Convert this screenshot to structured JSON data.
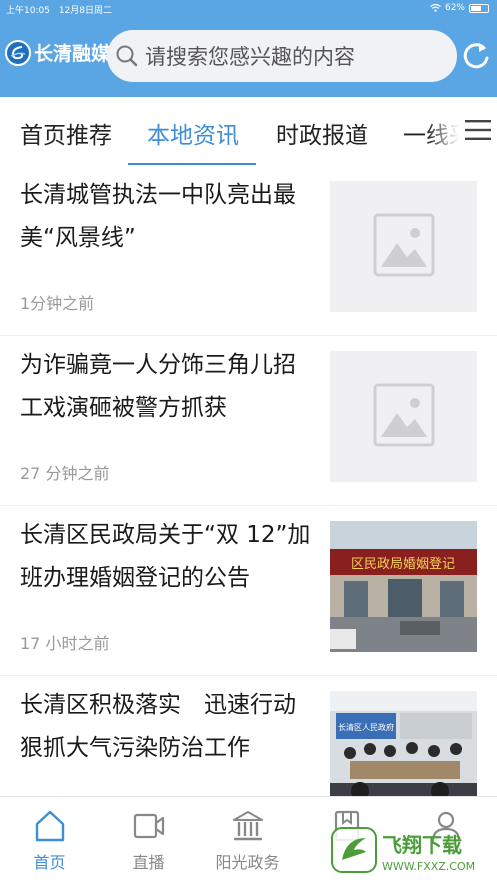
{
  "status_bar": {
    "time": "上午10:05",
    "date": "12月8日周二",
    "battery": "62%",
    "battery_level": 0.62
  },
  "header": {
    "app_name": "长清融媒",
    "search_placeholder": "请搜索您感兴趣的内容",
    "accent_color": "#5aa6e4"
  },
  "tabs": [
    {
      "label": "首页推荐",
      "active": false
    },
    {
      "label": "本地资讯",
      "active": true
    },
    {
      "label": "时政报道",
      "active": false
    },
    {
      "label": "一线采",
      "active": false
    }
  ],
  "news": [
    {
      "title": "长清城管执法一中队亮出最美“风景线”",
      "time": "1分钟之前",
      "image": "placeholder"
    },
    {
      "title": "为诈骗竟一人分饰三角儿招工戏演砸被警方抓获",
      "time": "27 分钟之前",
      "image": "placeholder"
    },
    {
      "title": "长清区民政局关于“双 12”加班办理婚姻登记的公告",
      "time": "17 小时之前",
      "image": "photo-building",
      "image_sign_text": "区民政局婚姻登记"
    },
    {
      "title": "长清区积极落实　迅速行动狠抓大气污染防治工作",
      "time": "",
      "image": "photo-meeting",
      "image_sign_text": "长清区人民政府"
    }
  ],
  "bottom_nav": [
    {
      "label": "首页",
      "icon": "home-icon",
      "active": true
    },
    {
      "label": "直播",
      "icon": "video-icon",
      "active": false
    },
    {
      "label": "阳光政务",
      "icon": "government-icon",
      "active": false
    },
    {
      "label": "",
      "icon": "bookmark-icon",
      "active": false
    },
    {
      "label": "",
      "icon": "user-icon",
      "active": false
    }
  ],
  "watermark": {
    "text": "飞翔下载",
    "url": "WWW.FXXZ.COM"
  }
}
